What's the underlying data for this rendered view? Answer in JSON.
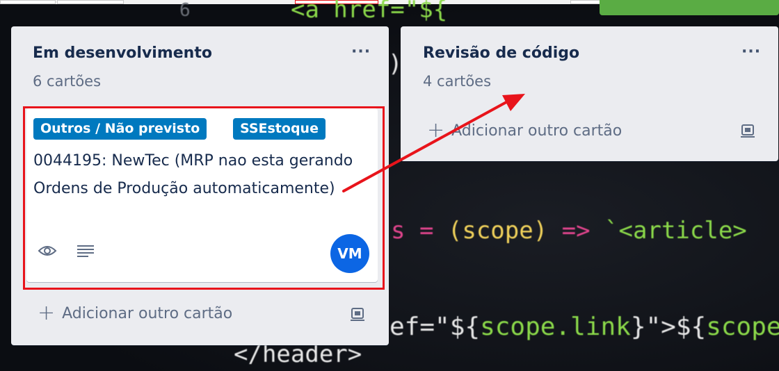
{
  "lists": [
    {
      "title": "Em desenvolvimento",
      "count": "6 cartões",
      "menu": "···",
      "add_card": "Adicionar outro cartão",
      "card": {
        "labels": [
          "Outros / Não previsto",
          "SSEstoque"
        ],
        "title": "0044195: NewTec (MRP nao esta gerando Ordens de Produção automaticamente)",
        "avatar_initials": "VM",
        "badges": [
          "eye-icon",
          "description-icon"
        ]
      }
    },
    {
      "title": "Revisão de código",
      "count": "4 cartões",
      "menu": "···",
      "add_card": "Adicionar outro cartão"
    }
  ],
  "background_code": {
    "line1": "<a href=\"${",
    "line2": "s = (scope) => `<article>",
    "line3": "ef=\"${scope.link}\">${scope.",
    "line4": "</header>",
    "digit": "6",
    "paren": ")"
  },
  "colors": {
    "list_bg": "#ebecf0",
    "label_blue": "#0079bf",
    "avatar_blue": "#0c66e4",
    "highlight_red": "#e8141b",
    "arrow_red": "#e8141b",
    "title_text": "#172b4d",
    "muted_text": "#5e6c84"
  }
}
